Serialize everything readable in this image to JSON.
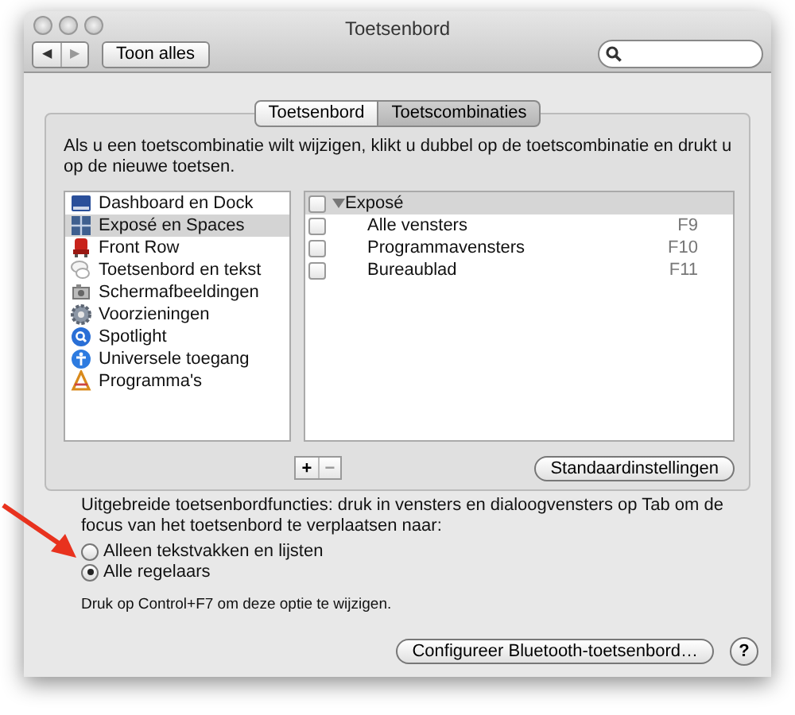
{
  "window": {
    "title": "Toetsenbord"
  },
  "toolbar": {
    "back_label": "◀",
    "forward_label": "▶",
    "show_all": "Toon alles"
  },
  "tabs": [
    {
      "label": "Toetsenbord",
      "selected": false
    },
    {
      "label": "Toetscombinaties",
      "selected": true
    }
  ],
  "instructions": "Als u een toetscombinatie wilt wijzigen, klikt u dubbel op de toetscombinatie en drukt u op de nieuwe toetsen.",
  "categories": [
    {
      "label": "Dashboard en Dock",
      "selected": false
    },
    {
      "label": "Exposé en Spaces",
      "selected": true
    },
    {
      "label": "Front Row",
      "selected": false
    },
    {
      "label": "Toetsenbord en tekst",
      "selected": false
    },
    {
      "label": "Schermafbeeldingen",
      "selected": false
    },
    {
      "label": "Voorzieningen",
      "selected": false
    },
    {
      "label": "Spotlight",
      "selected": false
    },
    {
      "label": "Universele toegang",
      "selected": false
    },
    {
      "label": "Programma's",
      "selected": false
    }
  ],
  "shortcuts": {
    "group": {
      "label": "Exposé",
      "checked": false,
      "expanded": true
    },
    "rows": [
      {
        "label": "Alle vensters",
        "key": "F9",
        "checked": false
      },
      {
        "label": "Programmavensters",
        "key": "F10",
        "checked": false
      },
      {
        "label": "Bureaublad",
        "key": "F11",
        "checked": false
      }
    ]
  },
  "add_label": "+",
  "remove_label": "−",
  "defaults_button": "Standaardinstellingen",
  "full_access_text": "Uitgebreide toetsenbordfuncties: druk in vensters en dialoogvensters op Tab om de focus van het toetsenbord te verplaatsen naar:",
  "focus_options": [
    {
      "label": "Alleen tekstvakken en lijsten",
      "selected": false
    },
    {
      "label": "Alle regelaars",
      "selected": true
    }
  ],
  "hint": "Druk op Control+F7 om deze optie te wijzigen.",
  "bluetooth_button": "Configureer Bluetooth-toetsenbord…",
  "help_label": "?"
}
